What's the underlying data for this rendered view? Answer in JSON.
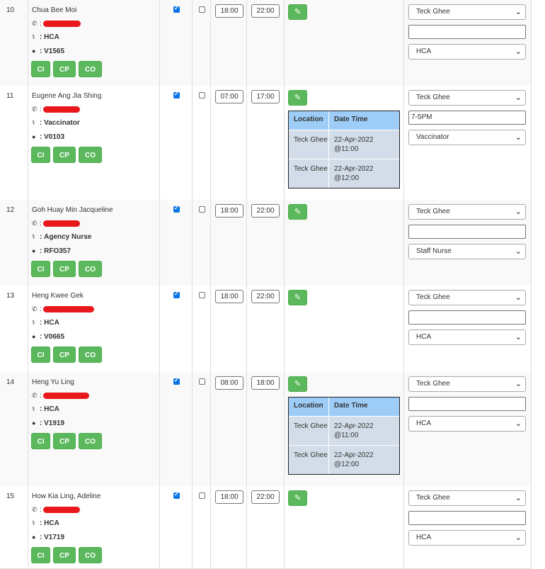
{
  "rows": [
    {
      "num": "10",
      "name": "Chua Bee Moi",
      "role": "HCA",
      "code": "V1565",
      "checked_a": true,
      "checked_b": false,
      "start": "18:00",
      "end": "22:00",
      "location": "Teck Ghee",
      "remark": "",
      "position": "HCA",
      "history": []
    },
    {
      "num": "11",
      "name": "Eugene Ang Jia Shing",
      "role": "Vaccinator",
      "code": "V0103",
      "checked_a": true,
      "checked_b": false,
      "start": "07:00",
      "end": "17:00",
      "location": "Teck Ghee",
      "remark": "7-5PM",
      "position": "Vaccinator",
      "history": [
        {
          "location": "Teck Ghee",
          "datetime": "22-Apr-2022 @11:00"
        },
        {
          "location": "Teck Ghee",
          "datetime": "22-Apr-2022 @12:00"
        }
      ]
    },
    {
      "num": "12",
      "name": "Goh Huay Min Jacqueline",
      "role": "Agency Nurse",
      "code": "RFO357",
      "checked_a": true,
      "checked_b": false,
      "start": "18:00",
      "end": "22:00",
      "location": "Teck Ghee",
      "remark": "",
      "position": "Staff Nurse",
      "history": []
    },
    {
      "num": "13",
      "name": "Heng Kwee Gek",
      "role": "HCA",
      "code": "V0665",
      "checked_a": true,
      "checked_b": false,
      "start": "18:00",
      "end": "22:00",
      "location": "Teck Ghee",
      "remark": "",
      "position": "HCA",
      "history": []
    },
    {
      "num": "14",
      "name": "Heng Yu Ling",
      "role": "HCA",
      "code": "V1919",
      "checked_a": true,
      "checked_b": false,
      "start": "08:00",
      "end": "18:00",
      "location": "Teck Ghee",
      "remark": "",
      "position": "HCA",
      "history": [
        {
          "location": "Teck Ghee",
          "datetime": "22-Apr-2022 @11:00"
        },
        {
          "location": "Teck Ghee",
          "datetime": "22-Apr-2022 @12:00"
        }
      ]
    },
    {
      "num": "15",
      "name": "How Kia Ling, Adeline",
      "role": "HCA",
      "code": "V1719",
      "checked_a": true,
      "checked_b": false,
      "start": "18:00",
      "end": "22:00",
      "location": "Teck Ghee",
      "remark": "",
      "position": "HCA",
      "history": []
    }
  ],
  "labels": {
    "sep": ":",
    "ci": "CI",
    "cp": "CP",
    "co": "CO",
    "hist_location": "Location",
    "hist_datetime": "Date Time"
  },
  "icons": {
    "phone": "phone-icon",
    "role": "user-md-icon",
    "code": "user-icon",
    "edit": "edit-icon",
    "chevron": "chevron-down-icon"
  },
  "colors": {
    "button_green": "#5cb85c",
    "checkbox_blue": "#0a76e5",
    "history_header": "#9dcdf7",
    "history_body": "#d3dde9",
    "redaction": "#e8181b"
  }
}
